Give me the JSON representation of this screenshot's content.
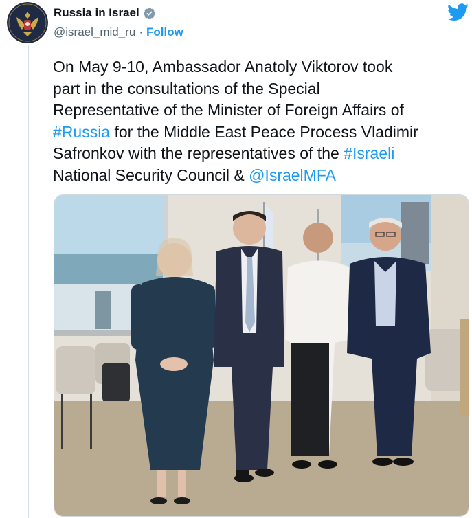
{
  "author": {
    "display_name": "Russia in Israel",
    "handle": "@israel_mid_ru",
    "separator": "·",
    "follow_label": "Follow",
    "verified": true,
    "avatar_icon": "russian-coat-of-arms-avatar"
  },
  "brand": {
    "icon": "twitter-bird-icon",
    "color": "#1d9bf0"
  },
  "tweet": {
    "line1": "On May 9-10, Ambassador Anatoly Viktorov took",
    "line2": "part in the consultations of the Special",
    "line3": "Representative of the Minister of Foreign Affairs of",
    "hashtag_russia": "#Russia",
    "line4_rest": " for the Middle East Peace Process Vladimir",
    "line5_start": "Safronkov with the representatives of the ",
    "hashtag_israeli": "#Israeli",
    "line6_start": "National Security Council & ",
    "mention": "@IsraelMFA"
  },
  "colors": {
    "text": "#0f1419",
    "secondary": "#536471",
    "accent": "#1d9bf0",
    "border": "#cfd9de"
  }
}
